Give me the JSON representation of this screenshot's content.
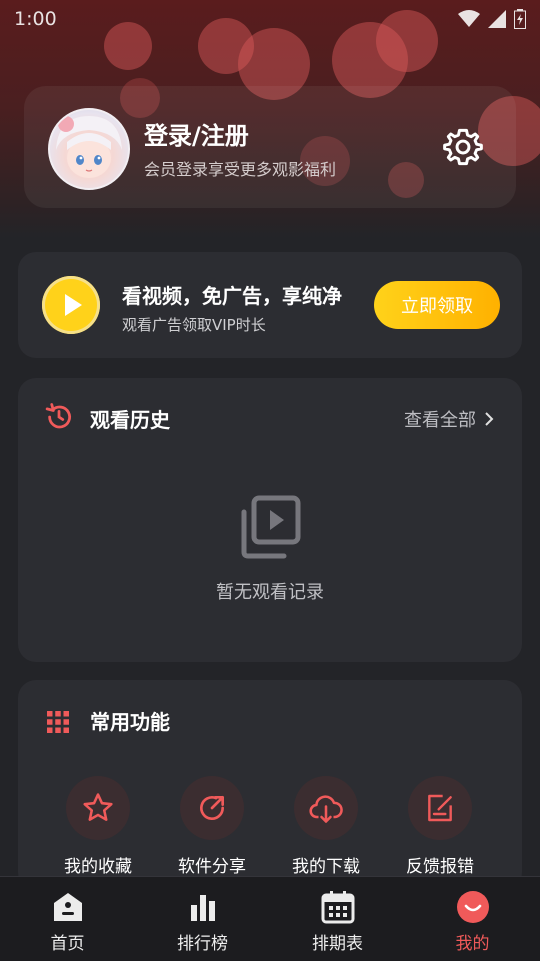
{
  "status_bar": {
    "time": "1:00"
  },
  "profile": {
    "title": "登录/注册",
    "subtitle": "会员登录享受更多观影福利"
  },
  "promo": {
    "title": "看视频，免广告，享纯净",
    "subtitle": "观看广告领取VIP时长",
    "button_label": "立即领取"
  },
  "history": {
    "title": "观看历史",
    "view_all": "查看全部",
    "empty_text": "暂无观看记录"
  },
  "functions": {
    "title": "常用功能",
    "items": [
      {
        "label": "我的收藏",
        "icon": "star-icon"
      },
      {
        "label": "软件分享",
        "icon": "share-icon"
      },
      {
        "label": "我的下载",
        "icon": "cloud-download-icon"
      },
      {
        "label": "反馈报错",
        "icon": "edit-note-icon"
      }
    ]
  },
  "tabbar": {
    "items": [
      {
        "label": "首页",
        "icon": "home-icon",
        "active": false
      },
      {
        "label": "排行榜",
        "icon": "bar-chart-icon",
        "active": false
      },
      {
        "label": "排期表",
        "icon": "calendar-icon",
        "active": false
      },
      {
        "label": "我的",
        "icon": "smile-face-icon",
        "active": true
      }
    ]
  },
  "colors": {
    "accent": "#f05a5a",
    "gold": "#ffd21a",
    "card_bg": "#2c2d32",
    "page_bg": "#232428"
  }
}
